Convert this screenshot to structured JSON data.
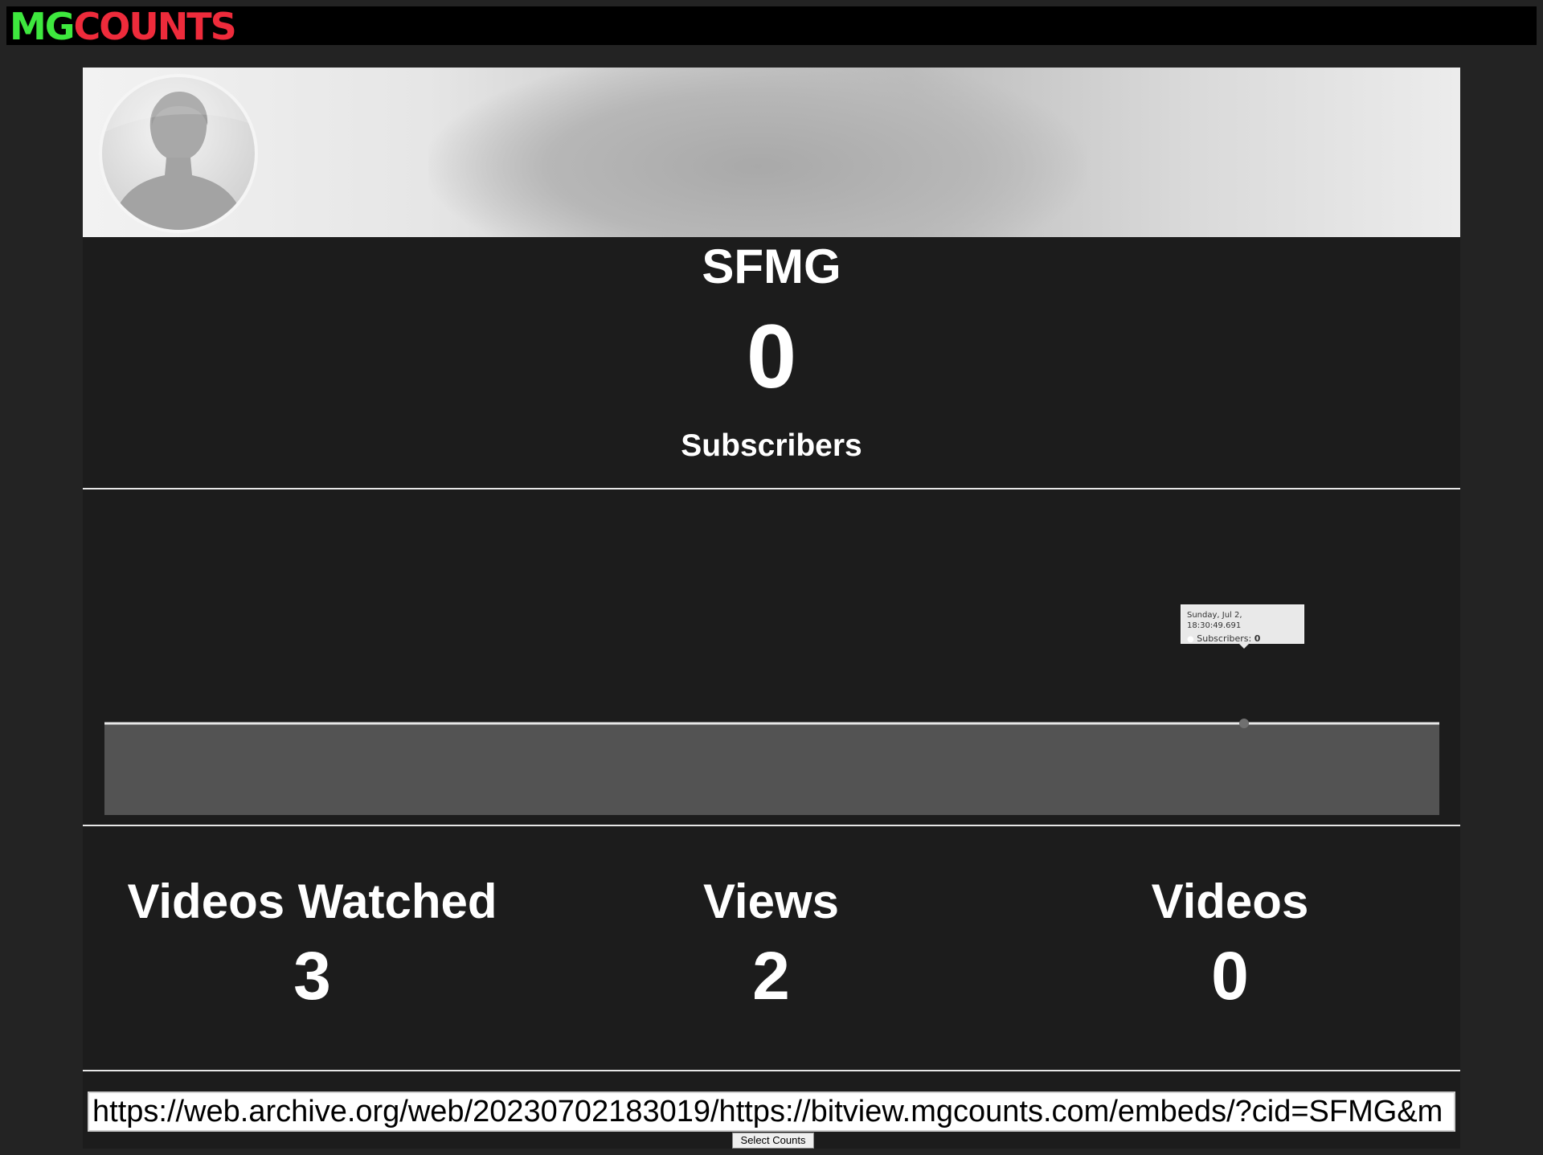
{
  "header": {
    "logo_part1": "MG",
    "logo_part2": "COUNTS",
    "logo_colors": {
      "mg": "#3ee83e",
      "counts": "#ee2b3b"
    }
  },
  "channel": {
    "avatar_icon": "default-user-silhouette-icon",
    "name": "SFMG",
    "subscriber_count": "0",
    "subscriber_label": "Subscribers"
  },
  "chart_data": {
    "type": "area",
    "series": [
      {
        "values": [
          0,
          0
        ]
      }
    ],
    "tooltip": {
      "date": "Sunday, Jul 2, 18:30:49.691",
      "label": "Subscribers:",
      "value": "0"
    },
    "colors": {
      "line": "#e8e8e8",
      "fill": "#535353",
      "point": "#707070"
    }
  },
  "stats": [
    {
      "label": "Videos Watched",
      "value": "3"
    },
    {
      "label": "Views",
      "value": "2"
    },
    {
      "label": "Videos",
      "value": "0"
    }
  ],
  "embed": {
    "url": "https://web.archive.org/web/20230702183019/https://bitview.mgcounts.com/embeds/?cid=SFMG&m"
  },
  "select_button": {
    "label": "Select Counts"
  }
}
